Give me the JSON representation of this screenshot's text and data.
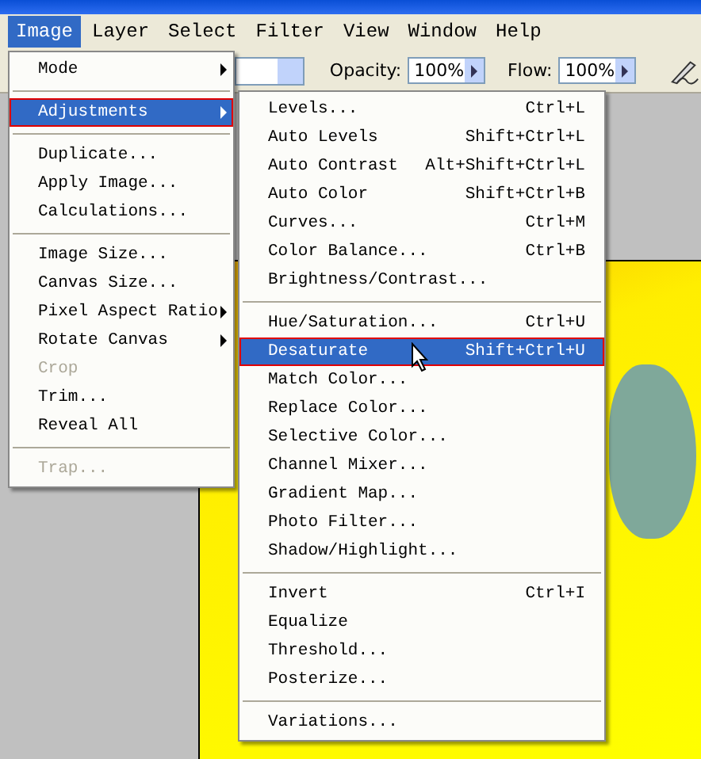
{
  "menu_bar": [
    {
      "label": "Image",
      "selected": true
    },
    {
      "label": "Layer",
      "selected": false
    },
    {
      "label": "Select",
      "selected": false
    },
    {
      "label": "Filter",
      "selected": false
    },
    {
      "label": "View",
      "selected": false
    },
    {
      "label": "Window",
      "selected": false
    },
    {
      "label": "Help",
      "selected": false
    }
  ],
  "options_bar": {
    "opacity_label": "Opacity:",
    "opacity_value": "100%",
    "flow_label": "Flow:",
    "flow_value": "100%"
  },
  "image_menu": [
    {
      "kind": "item",
      "label": "Mode",
      "submenu": true,
      "disabled": false,
      "selected": false,
      "marked": false
    },
    {
      "kind": "separator"
    },
    {
      "kind": "item",
      "label": "Adjustments",
      "submenu": true,
      "disabled": false,
      "selected": true,
      "marked": true
    },
    {
      "kind": "separator"
    },
    {
      "kind": "item",
      "label": "Duplicate...",
      "submenu": false,
      "disabled": false,
      "selected": false,
      "marked": false
    },
    {
      "kind": "item",
      "label": "Apply Image...",
      "submenu": false,
      "disabled": false,
      "selected": false,
      "marked": false
    },
    {
      "kind": "item",
      "label": "Calculations...",
      "submenu": false,
      "disabled": false,
      "selected": false,
      "marked": false
    },
    {
      "kind": "separator"
    },
    {
      "kind": "item",
      "label": "Image Size...",
      "submenu": false,
      "disabled": false,
      "selected": false,
      "marked": false
    },
    {
      "kind": "item",
      "label": "Canvas Size...",
      "submenu": false,
      "disabled": false,
      "selected": false,
      "marked": false
    },
    {
      "kind": "item",
      "label": "Pixel Aspect Ratio",
      "submenu": true,
      "disabled": false,
      "selected": false,
      "marked": false
    },
    {
      "kind": "item",
      "label": "Rotate Canvas",
      "submenu": true,
      "disabled": false,
      "selected": false,
      "marked": false
    },
    {
      "kind": "item",
      "label": "Crop",
      "submenu": false,
      "disabled": true,
      "selected": false,
      "marked": false
    },
    {
      "kind": "item",
      "label": "Trim...",
      "submenu": false,
      "disabled": false,
      "selected": false,
      "marked": false
    },
    {
      "kind": "item",
      "label": "Reveal All",
      "submenu": false,
      "disabled": false,
      "selected": false,
      "marked": false
    },
    {
      "kind": "separator"
    },
    {
      "kind": "item",
      "label": "Trap...",
      "submenu": false,
      "disabled": true,
      "selected": false,
      "marked": false
    }
  ],
  "adjustments_menu": [
    {
      "kind": "item",
      "label": "Levels...",
      "shortcut": "Ctrl+L",
      "selected": false,
      "marked": false
    },
    {
      "kind": "item",
      "label": "Auto Levels",
      "shortcut": "Shift+Ctrl+L",
      "selected": false,
      "marked": false
    },
    {
      "kind": "item",
      "label": "Auto Contrast",
      "shortcut": "Alt+Shift+Ctrl+L",
      "selected": false,
      "marked": false
    },
    {
      "kind": "item",
      "label": "Auto Color",
      "shortcut": "Shift+Ctrl+B",
      "selected": false,
      "marked": false
    },
    {
      "kind": "item",
      "label": "Curves...",
      "shortcut": "Ctrl+M",
      "selected": false,
      "marked": false
    },
    {
      "kind": "item",
      "label": "Color Balance...",
      "shortcut": "Ctrl+B",
      "selected": false,
      "marked": false
    },
    {
      "kind": "item",
      "label": "Brightness/Contrast...",
      "selected": false,
      "marked": false
    },
    {
      "kind": "separator"
    },
    {
      "kind": "item",
      "label": "Hue/Saturation...",
      "shortcut": "Ctrl+U",
      "selected": false,
      "marked": false
    },
    {
      "kind": "item",
      "label": "Desaturate",
      "shortcut": "Shift+Ctrl+U",
      "selected": true,
      "marked": true
    },
    {
      "kind": "item",
      "label": "Match Color...",
      "selected": false,
      "marked": false
    },
    {
      "kind": "item",
      "label": "Replace Color...",
      "selected": false,
      "marked": false
    },
    {
      "kind": "item",
      "label": "Selective Color...",
      "selected": false,
      "marked": false
    },
    {
      "kind": "item",
      "label": "Channel Mixer...",
      "selected": false,
      "marked": false
    },
    {
      "kind": "item",
      "label": "Gradient Map...",
      "selected": false,
      "marked": false
    },
    {
      "kind": "item",
      "label": "Photo Filter...",
      "selected": false,
      "marked": false
    },
    {
      "kind": "item",
      "label": "Shadow/Highlight...",
      "selected": false,
      "marked": false
    },
    {
      "kind": "separator"
    },
    {
      "kind": "item",
      "label": "Invert",
      "shortcut": "Ctrl+I",
      "selected": false,
      "marked": false
    },
    {
      "kind": "item",
      "label": "Equalize",
      "selected": false,
      "marked": false
    },
    {
      "kind": "item",
      "label": "Threshold...",
      "selected": false,
      "marked": false
    },
    {
      "kind": "item",
      "label": "Posterize...",
      "selected": false,
      "marked": false
    },
    {
      "kind": "separator"
    },
    {
      "kind": "item",
      "label": "Variations...",
      "selected": false,
      "marked": false
    }
  ]
}
